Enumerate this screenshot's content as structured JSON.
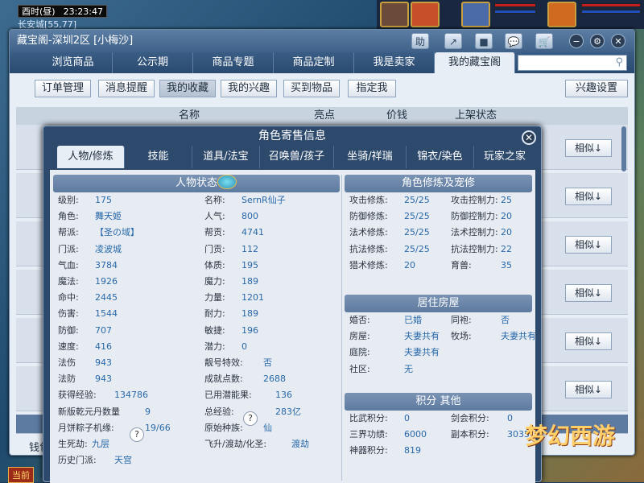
{
  "game": {
    "clock_period": "酉时(昼)",
    "clock_time": "23:23:47",
    "map_name": "长安城[55,77]",
    "current_label": "当前",
    "logo_text": "梦幻西游"
  },
  "window": {
    "title": "藏宝阁-深圳2区 [小梅沙]",
    "title_buttons": [
      "助",
      "↗",
      "■",
      "💬",
      "🛒"
    ],
    "round_buttons": [
      "−",
      "⚙",
      "✕"
    ],
    "tabs": [
      "浏览商品",
      "公示期",
      "商品专题",
      "商品定制",
      "我是卖家",
      "我的藏宝阁"
    ],
    "active_tab": "我的藏宝阁",
    "search_placeholder": "",
    "subnav": [
      "订单管理",
      "消息提醒",
      "我的收藏",
      "我的兴趣",
      "买到物品",
      "指定我"
    ],
    "subnav_active": "我的收藏",
    "interest_settings": "兴趣设置",
    "columns": [
      "名称",
      "亮点",
      "价钱",
      "上架状态"
    ],
    "similar_label": "相似↓",
    "money_label": "钱包"
  },
  "modal": {
    "title": "角色寄售信息",
    "tabs": [
      "人物/修炼",
      "技能",
      "道具/法宝",
      "召唤兽/孩子",
      "坐骑/祥瑞",
      "锦衣/染色",
      "玩家之家"
    ],
    "active_tab": "人物/修炼",
    "char_status": {
      "header": "人物状态",
      "left": [
        {
          "label": "级别:",
          "value": "175"
        },
        {
          "label": "角色:",
          "value": "舞天姬"
        },
        {
          "label": "帮派:",
          "value": "【圣の域】"
        },
        {
          "label": "门派:",
          "value": "凌波城"
        },
        {
          "label": "气血:",
          "value": "3784"
        },
        {
          "label": "魔法:",
          "value": "1926"
        },
        {
          "label": "命中:",
          "value": "2445"
        },
        {
          "label": "伤害:",
          "value": "1544"
        },
        {
          "label": "防御:",
          "value": "707"
        },
        {
          "label": "速度:",
          "value": "416"
        },
        {
          "label": "法伤",
          "value": "943"
        },
        {
          "label": "法防",
          "value": "943"
        },
        {
          "label": "获得经验:",
          "value": "134786"
        },
        {
          "label": "新版乾元丹数量",
          "value": "9"
        },
        {
          "label": "月饼粽子机缘:",
          "value": "19/66"
        },
        {
          "label": "生死劫:",
          "value": "九层"
        },
        {
          "label": "历史门派:",
          "value": "天宫"
        }
      ],
      "right": [
        {
          "label": "名称:",
          "value": "SernR仙子"
        },
        {
          "label": "人气:",
          "value": "800"
        },
        {
          "label": "帮贡:",
          "value": "4741"
        },
        {
          "label": "门贡:",
          "value": "112"
        },
        {
          "label": "体质:",
          "value": "195"
        },
        {
          "label": "魔力:",
          "value": "189"
        },
        {
          "label": "力量:",
          "value": "1201"
        },
        {
          "label": "耐力:",
          "value": "189"
        },
        {
          "label": "敏捷:",
          "value": "196"
        },
        {
          "label": "潜力:",
          "value": "0"
        },
        {
          "label": "靓号特效:",
          "value": "否"
        },
        {
          "label": "成就点数:",
          "value": "2688"
        },
        {
          "label": "已用潜能果:",
          "value": "136"
        },
        {
          "label": "总经验:",
          "value": "283亿"
        },
        {
          "label": "原始种族:",
          "value": "仙"
        },
        {
          "label": "飞升/渡劫/化圣:",
          "value": "渡劫"
        }
      ]
    },
    "cultivation": {
      "header": "角色修炼及宠修",
      "rows": [
        {
          "l1": "攻击修炼:",
          "v1": "25/25",
          "l2": "攻击控制力:",
          "v2": "25"
        },
        {
          "l1": "防御修炼:",
          "v1": "25/25",
          "l2": "防御控制力:",
          "v2": "20"
        },
        {
          "l1": "法术修炼:",
          "v1": "25/25",
          "l2": "法术控制力:",
          "v2": "20"
        },
        {
          "l1": "抗法修炼:",
          "v1": "25/25",
          "l2": "抗法控制力:",
          "v2": "22"
        },
        {
          "l1": "猎术修炼:",
          "v1": "20",
          "l2": "育兽:",
          "v2": "35"
        }
      ]
    },
    "house": {
      "header": "居住房屋",
      "rows": [
        {
          "l1": "婚否:",
          "v1": "已婚",
          "l2": "同袍:",
          "v2": "否"
        },
        {
          "l1": "房屋:",
          "v1": "夫妻共有",
          "l2": "牧场:",
          "v2": "夫妻共有"
        },
        {
          "l1": "庭院:",
          "v1": "夫妻共有",
          "l2": "",
          "v2": ""
        },
        {
          "l1": "社区:",
          "v1": "无",
          "l2": "",
          "v2": ""
        }
      ]
    },
    "points": {
      "header": "积分 其他",
      "rows": [
        {
          "l1": "比武积分:",
          "v1": "0",
          "l2": "剑会积分:",
          "v2": "0"
        },
        {
          "l1": "三界功绩:",
          "v1": "6000",
          "l2": "副本积分:",
          "v2": "3035"
        },
        {
          "l1": "神器积分:",
          "v1": "819",
          "l2": "",
          "v2": ""
        }
      ]
    }
  }
}
